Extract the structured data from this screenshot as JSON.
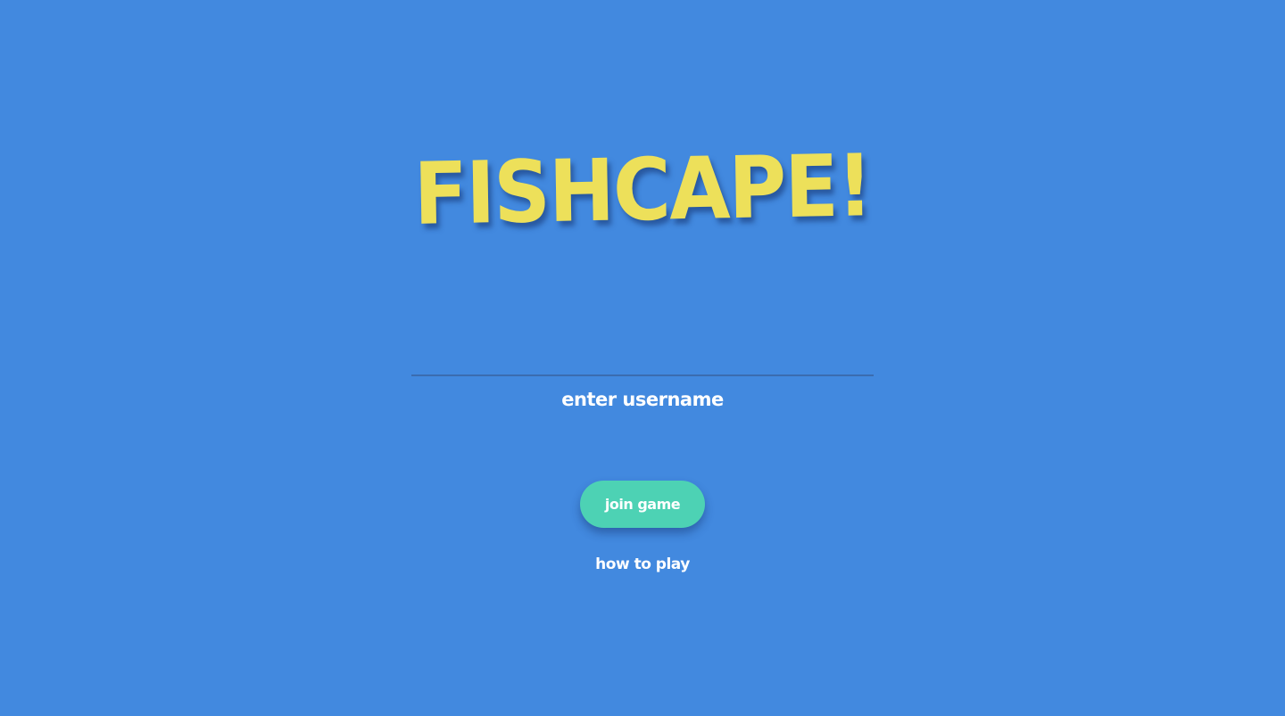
{
  "game": {
    "title": "FISHCAPE!"
  },
  "login": {
    "username_value": "",
    "username_label": "enter username",
    "join_label": "join game",
    "how_to_play_label": "how to play"
  },
  "colors": {
    "background": "#4289df",
    "title": "#ede05a",
    "join_button": "#4dd2b4",
    "text": "#ffffff"
  }
}
